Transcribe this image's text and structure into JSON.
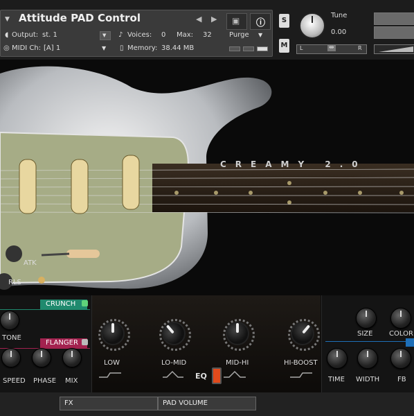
{
  "header": {
    "title": "Attitude PAD Control",
    "output_label": "Output:",
    "output_value": "st. 1",
    "voices_label": "Voices:",
    "voices_value": "0",
    "max_label": "Max:",
    "max_value": "32",
    "purge_label": "Purge",
    "midi_label": "MIDI Ch:",
    "midi_value": "[A]  1",
    "memory_label": "Memory:",
    "memory_value": "38.44 MB",
    "tune_label": "Tune",
    "tune_value": "0.00",
    "solo_label": "S",
    "mute_label": "M",
    "pan_left": "L",
    "pan_right": "R"
  },
  "artwork": {
    "brand_text": "CREAMY 2.0",
    "atk_label": "ATK",
    "rls_label": "RLS"
  },
  "controls": {
    "crunch_label": "CRUNCH",
    "tone_label": "TONE",
    "flanger_label": "FLANGER",
    "speed_label": "SPEED",
    "phase_label": "PHASE",
    "mix_label": "MIX",
    "low_label": "LOW",
    "lomid_label": "LO-MID",
    "midhi_label": "MID-HI",
    "hiboost_label": "HI-BOOST",
    "eq_label": "EQ",
    "size_label": "SIZE",
    "color_label": "COLOR",
    "time_label": "TIME",
    "width_label": "WIDTH",
    "fb_label": "FB"
  },
  "footer": {
    "fx_label": "FX",
    "pad_volume_label": "PAD VOLUME"
  },
  "colors": {
    "crunch": "#1f8a6e",
    "flanger": "#a3224f",
    "eq_led": "#e24a1c",
    "delay_accent": "#1e6fb8"
  }
}
